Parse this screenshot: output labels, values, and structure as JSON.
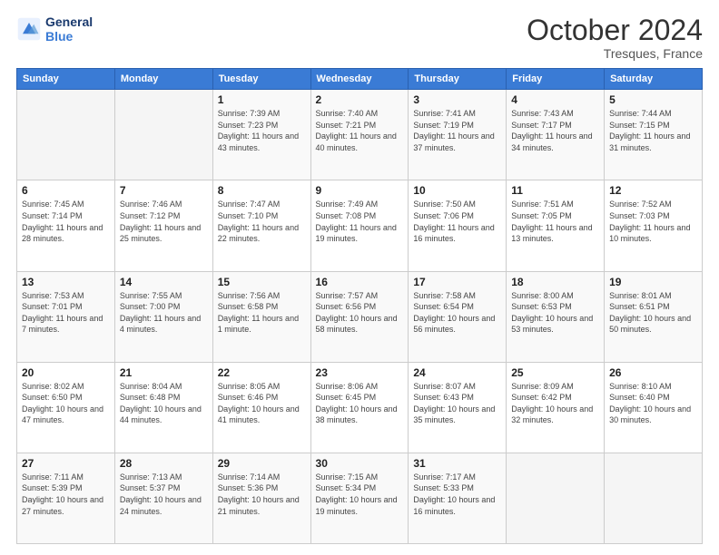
{
  "logo": {
    "line1": "General",
    "line2": "Blue"
  },
  "header": {
    "month": "October 2024",
    "location": "Tresques, France"
  },
  "weekdays": [
    "Sunday",
    "Monday",
    "Tuesday",
    "Wednesday",
    "Thursday",
    "Friday",
    "Saturday"
  ],
  "weeks": [
    [
      {
        "day": "",
        "sunrise": "",
        "sunset": "",
        "daylight": ""
      },
      {
        "day": "",
        "sunrise": "",
        "sunset": "",
        "daylight": ""
      },
      {
        "day": "1",
        "sunrise": "Sunrise: 7:39 AM",
        "sunset": "Sunset: 7:23 PM",
        "daylight": "Daylight: 11 hours and 43 minutes."
      },
      {
        "day": "2",
        "sunrise": "Sunrise: 7:40 AM",
        "sunset": "Sunset: 7:21 PM",
        "daylight": "Daylight: 11 hours and 40 minutes."
      },
      {
        "day": "3",
        "sunrise": "Sunrise: 7:41 AM",
        "sunset": "Sunset: 7:19 PM",
        "daylight": "Daylight: 11 hours and 37 minutes."
      },
      {
        "day": "4",
        "sunrise": "Sunrise: 7:43 AM",
        "sunset": "Sunset: 7:17 PM",
        "daylight": "Daylight: 11 hours and 34 minutes."
      },
      {
        "day": "5",
        "sunrise": "Sunrise: 7:44 AM",
        "sunset": "Sunset: 7:15 PM",
        "daylight": "Daylight: 11 hours and 31 minutes."
      }
    ],
    [
      {
        "day": "6",
        "sunrise": "Sunrise: 7:45 AM",
        "sunset": "Sunset: 7:14 PM",
        "daylight": "Daylight: 11 hours and 28 minutes."
      },
      {
        "day": "7",
        "sunrise": "Sunrise: 7:46 AM",
        "sunset": "Sunset: 7:12 PM",
        "daylight": "Daylight: 11 hours and 25 minutes."
      },
      {
        "day": "8",
        "sunrise": "Sunrise: 7:47 AM",
        "sunset": "Sunset: 7:10 PM",
        "daylight": "Daylight: 11 hours and 22 minutes."
      },
      {
        "day": "9",
        "sunrise": "Sunrise: 7:49 AM",
        "sunset": "Sunset: 7:08 PM",
        "daylight": "Daylight: 11 hours and 19 minutes."
      },
      {
        "day": "10",
        "sunrise": "Sunrise: 7:50 AM",
        "sunset": "Sunset: 7:06 PM",
        "daylight": "Daylight: 11 hours and 16 minutes."
      },
      {
        "day": "11",
        "sunrise": "Sunrise: 7:51 AM",
        "sunset": "Sunset: 7:05 PM",
        "daylight": "Daylight: 11 hours and 13 minutes."
      },
      {
        "day": "12",
        "sunrise": "Sunrise: 7:52 AM",
        "sunset": "Sunset: 7:03 PM",
        "daylight": "Daylight: 11 hours and 10 minutes."
      }
    ],
    [
      {
        "day": "13",
        "sunrise": "Sunrise: 7:53 AM",
        "sunset": "Sunset: 7:01 PM",
        "daylight": "Daylight: 11 hours and 7 minutes."
      },
      {
        "day": "14",
        "sunrise": "Sunrise: 7:55 AM",
        "sunset": "Sunset: 7:00 PM",
        "daylight": "Daylight: 11 hours and 4 minutes."
      },
      {
        "day": "15",
        "sunrise": "Sunrise: 7:56 AM",
        "sunset": "Sunset: 6:58 PM",
        "daylight": "Daylight: 11 hours and 1 minute."
      },
      {
        "day": "16",
        "sunrise": "Sunrise: 7:57 AM",
        "sunset": "Sunset: 6:56 PM",
        "daylight": "Daylight: 10 hours and 58 minutes."
      },
      {
        "day": "17",
        "sunrise": "Sunrise: 7:58 AM",
        "sunset": "Sunset: 6:54 PM",
        "daylight": "Daylight: 10 hours and 56 minutes."
      },
      {
        "day": "18",
        "sunrise": "Sunrise: 8:00 AM",
        "sunset": "Sunset: 6:53 PM",
        "daylight": "Daylight: 10 hours and 53 minutes."
      },
      {
        "day": "19",
        "sunrise": "Sunrise: 8:01 AM",
        "sunset": "Sunset: 6:51 PM",
        "daylight": "Daylight: 10 hours and 50 minutes."
      }
    ],
    [
      {
        "day": "20",
        "sunrise": "Sunrise: 8:02 AM",
        "sunset": "Sunset: 6:50 PM",
        "daylight": "Daylight: 10 hours and 47 minutes."
      },
      {
        "day": "21",
        "sunrise": "Sunrise: 8:04 AM",
        "sunset": "Sunset: 6:48 PM",
        "daylight": "Daylight: 10 hours and 44 minutes."
      },
      {
        "day": "22",
        "sunrise": "Sunrise: 8:05 AM",
        "sunset": "Sunset: 6:46 PM",
        "daylight": "Daylight: 10 hours and 41 minutes."
      },
      {
        "day": "23",
        "sunrise": "Sunrise: 8:06 AM",
        "sunset": "Sunset: 6:45 PM",
        "daylight": "Daylight: 10 hours and 38 minutes."
      },
      {
        "day": "24",
        "sunrise": "Sunrise: 8:07 AM",
        "sunset": "Sunset: 6:43 PM",
        "daylight": "Daylight: 10 hours and 35 minutes."
      },
      {
        "day": "25",
        "sunrise": "Sunrise: 8:09 AM",
        "sunset": "Sunset: 6:42 PM",
        "daylight": "Daylight: 10 hours and 32 minutes."
      },
      {
        "day": "26",
        "sunrise": "Sunrise: 8:10 AM",
        "sunset": "Sunset: 6:40 PM",
        "daylight": "Daylight: 10 hours and 30 minutes."
      }
    ],
    [
      {
        "day": "27",
        "sunrise": "Sunrise: 7:11 AM",
        "sunset": "Sunset: 5:39 PM",
        "daylight": "Daylight: 10 hours and 27 minutes."
      },
      {
        "day": "28",
        "sunrise": "Sunrise: 7:13 AM",
        "sunset": "Sunset: 5:37 PM",
        "daylight": "Daylight: 10 hours and 24 minutes."
      },
      {
        "day": "29",
        "sunrise": "Sunrise: 7:14 AM",
        "sunset": "Sunset: 5:36 PM",
        "daylight": "Daylight: 10 hours and 21 minutes."
      },
      {
        "day": "30",
        "sunrise": "Sunrise: 7:15 AM",
        "sunset": "Sunset: 5:34 PM",
        "daylight": "Daylight: 10 hours and 19 minutes."
      },
      {
        "day": "31",
        "sunrise": "Sunrise: 7:17 AM",
        "sunset": "Sunset: 5:33 PM",
        "daylight": "Daylight: 10 hours and 16 minutes."
      },
      {
        "day": "",
        "sunrise": "",
        "sunset": "",
        "daylight": ""
      },
      {
        "day": "",
        "sunrise": "",
        "sunset": "",
        "daylight": ""
      }
    ]
  ]
}
